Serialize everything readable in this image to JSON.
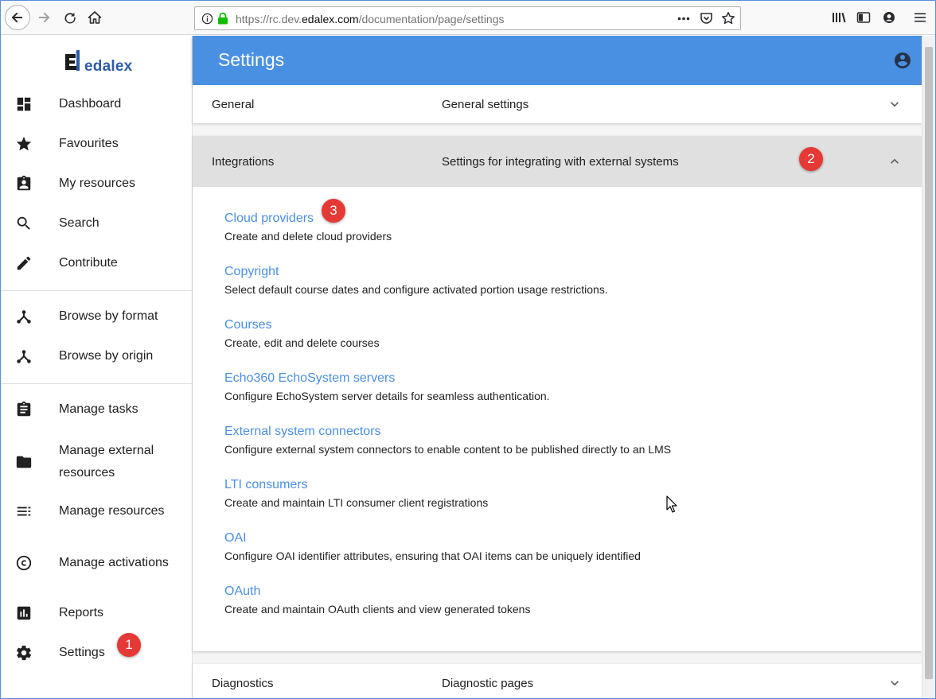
{
  "browser": {
    "url_prefix": "https://rc.dev.",
    "url_host": "edalex.com",
    "url_path": "/documentation/page/settings"
  },
  "brand": {
    "logo_text": "edalex"
  },
  "sidebar": {
    "items": [
      {
        "label": "Dashboard",
        "icon": "dashboard-icon"
      },
      {
        "label": "Favourites",
        "icon": "star-icon"
      },
      {
        "label": "My resources",
        "icon": "assignment-ind-icon"
      },
      {
        "label": "Search",
        "icon": "search-icon"
      },
      {
        "label": "Contribute",
        "icon": "pencil-icon"
      },
      {
        "label": "Browse by format",
        "icon": "hierarchy-icon"
      },
      {
        "label": "Browse by origin",
        "icon": "hierarchy-icon"
      },
      {
        "label": "Manage tasks",
        "icon": "clipboard-icon"
      },
      {
        "label": "Manage external resources",
        "icon": "folder-icon"
      },
      {
        "label": "Manage resources",
        "icon": "list-icon"
      },
      {
        "label": "Manage activations",
        "icon": "copyright-icon"
      },
      {
        "label": "Reports",
        "icon": "bar-chart-icon"
      },
      {
        "label": "Settings",
        "icon": "gear-icon"
      }
    ]
  },
  "header": {
    "title": "Settings"
  },
  "panels": {
    "general": {
      "title": "General",
      "description": "General settings"
    },
    "integrations": {
      "title": "Integrations",
      "description": "Settings for integrating with external systems",
      "items": [
        {
          "name": "Cloud providers",
          "description": "Create and delete cloud providers"
        },
        {
          "name": "Copyright",
          "description": "Select default course dates and configure activated portion usage restrictions."
        },
        {
          "name": "Courses",
          "description": "Create, edit and delete courses"
        },
        {
          "name": "Echo360 EchoSystem servers",
          "description": "Configure EchoSystem server details for seamless authentication."
        },
        {
          "name": "External system connectors",
          "description": "Configure external system connectors to enable content to be published directly to an LMS"
        },
        {
          "name": "LTI consumers",
          "description": "Create and maintain LTI consumer client registrations"
        },
        {
          "name": "OAI",
          "description": "Configure OAI identifier attributes, ensuring that OAI items can be uniquely identified"
        },
        {
          "name": "OAuth",
          "description": "Create and maintain OAuth clients and view generated tokens"
        }
      ]
    },
    "diagnostics": {
      "title": "Diagnostics",
      "description": "Diagnostic pages"
    }
  },
  "callouts": {
    "one": "1",
    "two": "2",
    "three": "3"
  },
  "colors": {
    "accent": "#4a90e2",
    "callout": "#e53935",
    "link": "#4a90e2"
  }
}
